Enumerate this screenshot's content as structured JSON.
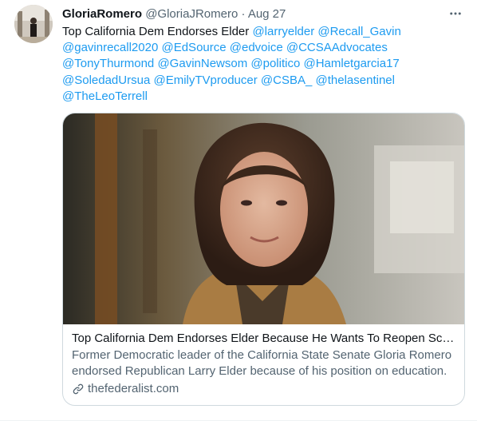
{
  "tweet": {
    "display_name": "GloriaRomero",
    "handle": "@GloriaJRomero",
    "separator": "·",
    "date": "Aug 27",
    "more_icon": "more-horizontal-icon",
    "text_segments": [
      {
        "text": "Top California Dem Endorses Elder ",
        "type": "text"
      },
      {
        "text": "@larryelder",
        "type": "mention"
      },
      {
        "text": " ",
        "type": "text"
      },
      {
        "text": "@Recall_Gavin",
        "type": "mention"
      },
      {
        "text": " ",
        "type": "text"
      },
      {
        "text": "@gavinrecall2020",
        "type": "mention"
      },
      {
        "text": " ",
        "type": "text"
      },
      {
        "text": "@EdSource",
        "type": "mention"
      },
      {
        "text": " ",
        "type": "text"
      },
      {
        "text": "@edvoice",
        "type": "mention"
      },
      {
        "text": " ",
        "type": "text"
      },
      {
        "text": "@CCSAAdvocates",
        "type": "mention"
      },
      {
        "text": " ",
        "type": "text"
      },
      {
        "text": "@TonyThurmond",
        "type": "mention"
      },
      {
        "text": " ",
        "type": "text"
      },
      {
        "text": "@GavinNewsom",
        "type": "mention"
      },
      {
        "text": " ",
        "type": "text"
      },
      {
        "text": "@politico",
        "type": "mention"
      },
      {
        "text": " ",
        "type": "text"
      },
      {
        "text": "@Hamletgarcia17",
        "type": "mention"
      },
      {
        "text": " ",
        "type": "text"
      },
      {
        "text": "@SoledadUrsua",
        "type": "mention"
      },
      {
        "text": " ",
        "type": "text"
      },
      {
        "text": "@EmilyTVproducer",
        "type": "mention"
      },
      {
        "text": " ",
        "type": "text"
      },
      {
        "text": "@CSBA_",
        "type": "mention"
      },
      {
        "text": " ",
        "type": "text"
      },
      {
        "text": "@thelasentinel",
        "type": "mention"
      },
      {
        "text": " ",
        "type": "text"
      },
      {
        "text": "@TheLeoTerrell",
        "type": "mention"
      }
    ]
  },
  "card": {
    "title": "Top California Dem Endorses Elder Because He Wants To Reopen Sch...",
    "description": "Former Democratic leader of the California State Senate Gloria Romero endorsed Republican Larry Elder because of his position on education.",
    "domain": "thefederalist.com",
    "link_icon": "link-icon"
  },
  "colors": {
    "mention": "#1d9bf0",
    "secondary_text": "#536471",
    "border": "#cfd9de"
  }
}
